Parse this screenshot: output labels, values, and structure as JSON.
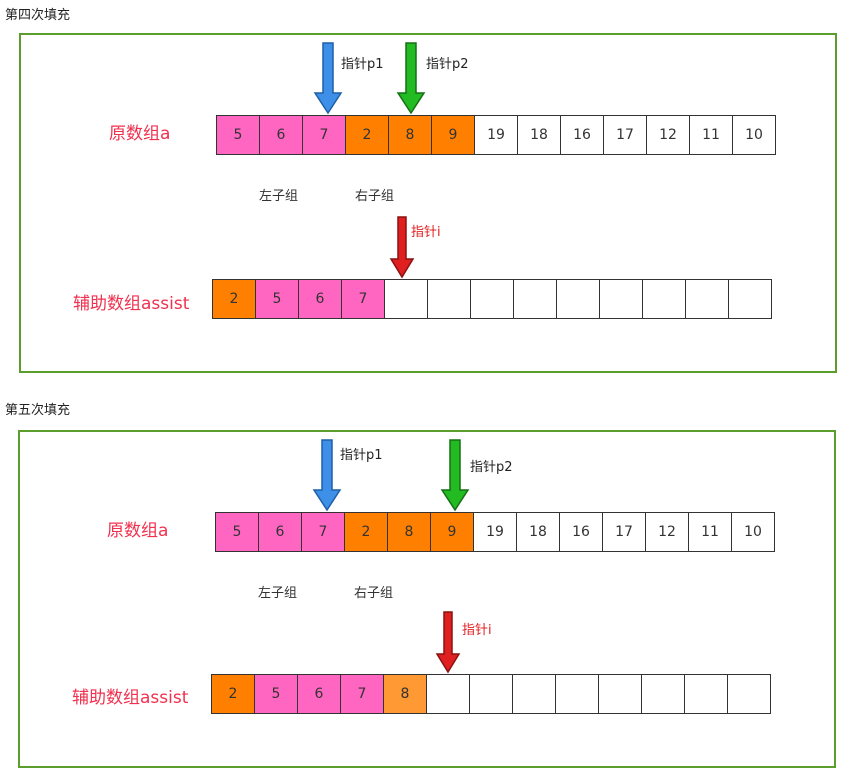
{
  "colors": {
    "left": "#ff66c2",
    "right": "#ff8000",
    "copied_right": "#ff9933",
    "empty": "#ffffff",
    "frame": "#5b9e2e",
    "label": "#f0304e",
    "p1_arrow": "#3d8fe8",
    "p2_arrow": "#22bb22",
    "i_arrow": "#e02020"
  },
  "panels": [
    {
      "heading": "第四次填充",
      "array_a_label": "原数组a",
      "assist_label": "辅助数组assist",
      "left_group_label": "左子组",
      "right_group_label": "右子组",
      "pointer_p1_label": "指针p1",
      "pointer_p2_label": "指针p2",
      "pointer_i_label": "指针i",
      "array_a": [
        "5",
        "6",
        "7",
        "2",
        "8",
        "9",
        "19",
        "18",
        "16",
        "17",
        "12",
        "11",
        "10"
      ],
      "array_a_colors": [
        "left",
        "left",
        "left",
        "right",
        "right",
        "right",
        "empty",
        "empty",
        "empty",
        "empty",
        "empty",
        "empty",
        "empty"
      ],
      "assist": [
        "2",
        "5",
        "6",
        "7",
        "",
        "",
        "",
        "",
        "",
        "",
        "",
        "",
        ""
      ],
      "assist_colors": [
        "right",
        "left",
        "left",
        "left",
        "empty",
        "empty",
        "empty",
        "empty",
        "empty",
        "empty",
        "empty",
        "empty",
        "empty"
      ]
    },
    {
      "heading": "第五次填充",
      "array_a_label": "原数组a",
      "assist_label": "辅助数组assist",
      "left_group_label": "左子组",
      "right_group_label": "右子组",
      "pointer_p1_label": "指针p1",
      "pointer_p2_label": "指针p2",
      "pointer_i_label": "指针i",
      "array_a": [
        "5",
        "6",
        "7",
        "2",
        "8",
        "9",
        "19",
        "18",
        "16",
        "17",
        "12",
        "11",
        "10"
      ],
      "array_a_colors": [
        "left",
        "left",
        "left",
        "right",
        "right",
        "right",
        "empty",
        "empty",
        "empty",
        "empty",
        "empty",
        "empty",
        "empty"
      ],
      "assist": [
        "2",
        "5",
        "6",
        "7",
        "8",
        "",
        "",
        "",
        "",
        "",
        "",
        "",
        ""
      ],
      "assist_colors": [
        "right",
        "left",
        "left",
        "left",
        "copied_right",
        "empty",
        "empty",
        "empty",
        "empty",
        "empty",
        "empty",
        "empty",
        "empty"
      ]
    }
  ]
}
